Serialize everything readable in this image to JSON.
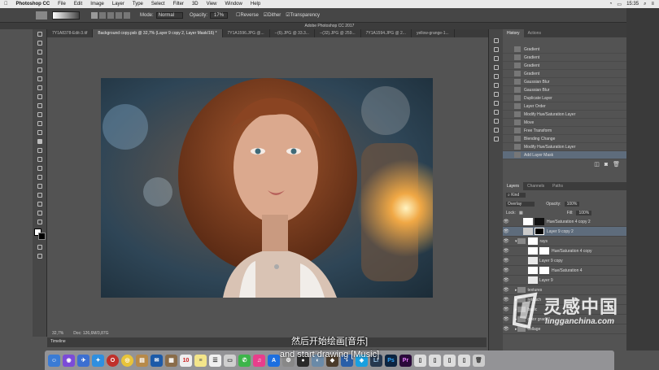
{
  "menubar": {
    "app": "Photoshop CC",
    "items": [
      "File",
      "Edit",
      "Image",
      "Layer",
      "Type",
      "Select",
      "Filter",
      "3D",
      "View",
      "Window",
      "Help"
    ],
    "clock": "15:35"
  },
  "window": {
    "title": "Adobe Photoshop CC 2017"
  },
  "options": {
    "mode_label": "Mode:",
    "mode_value": "Normal",
    "opacity_label": "Opacity:",
    "opacity_value": "17%",
    "reverse": "Reverse",
    "dither": "Dither",
    "transparency": "Transparency"
  },
  "tabs": [
    "7Y1A8378-Edit-3.tif",
    "Background copy.psb @ 32,7% (Layer 9 copy 2, Layer Mask/16) *",
    "7Y1A1596.JPG @...",
    "--(6).JPG @ 33.3...",
    "--(32).JPG @ 259...",
    "7Y1A1594.JPG @ 2...",
    "yellow-grange-1..."
  ],
  "status": {
    "zoom": "32,7%",
    "doc": "Doc: 126,6M/3,87G"
  },
  "timeline": {
    "label": "Timeline"
  },
  "history": {
    "tabs": [
      "History",
      "Actions"
    ],
    "items": [
      "Gradient",
      "Gradient",
      "Gradient",
      "Gradient",
      "Gaussian Blur",
      "Gaussian Blur",
      "Duplicate Layer",
      "Layer Order",
      "Modify Hue/Saturation Layer",
      "Move",
      "Free Transform",
      "Blending Change",
      "Modify Hue/Saturation Layer",
      "Add Layer Mask"
    ]
  },
  "layers": {
    "tabs": [
      "Layers",
      "Channels",
      "Paths"
    ],
    "kind": "Kind",
    "blend": "Overlay",
    "opacity_label": "Opacity:",
    "opacity_value": "100%",
    "lock_label": "Lock:",
    "fill_label": "Fill:",
    "fill_value": "100%",
    "rows": [
      "Hue/Saturation 4 copy 2",
      "Layer 9 copy 2",
      "rays",
      "Hue/Saturation 4 copy",
      "Layer 9 copy",
      "Hue/Saturation 4",
      "Layer 9",
      "textures",
      "retouch",
      "basic",
      "color grade",
      "collage"
    ]
  },
  "subtitles": {
    "cn": "然后开始绘画[音乐]",
    "en": "and start drawing [Music]"
  },
  "watermark": {
    "cn": "灵感中国",
    "en": "lingganchina.com"
  },
  "dock": [
    "Lr",
    "Ps",
    "Pr"
  ],
  "calendar_day": "10"
}
